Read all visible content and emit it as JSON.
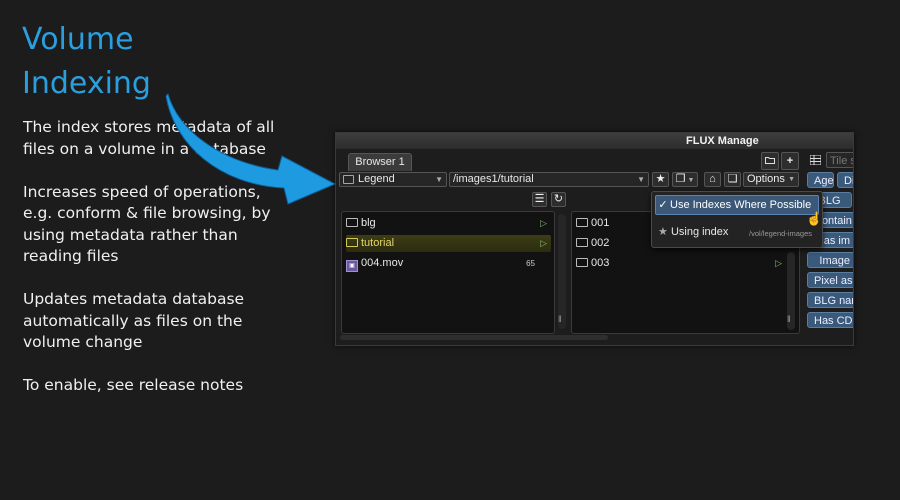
{
  "slide": {
    "title": "Volume Indexing",
    "bullets": [
      "The index stores metadata of all files on a volume in a database",
      "Increases speed of operations, e.g. conform & file browsing, by using metadata rather than reading files",
      "Updates metadata database automatically as files on the volume change",
      "To enable, see release notes"
    ],
    "title_color": "#2a9fe0",
    "arrow_color": "#1e9be0"
  },
  "app": {
    "window_title": "FLUX Manage",
    "tab_label": "Browser 1",
    "new_folder_btn": "folder-icon",
    "add_btn": "+",
    "search_placeholder": "Tile s",
    "legend_select": "Legend",
    "path_select": "/images1/tutorial",
    "options_label": "Options",
    "left_pane": [
      {
        "name": "blg",
        "type": "folder"
      },
      {
        "name": "tutorial",
        "type": "folder",
        "selected": true
      },
      {
        "name": "004.mov",
        "type": "movie",
        "count": "65"
      }
    ],
    "right_pane": [
      {
        "name": "001"
      },
      {
        "name": "002"
      },
      {
        "name": "003"
      }
    ],
    "dropdown": {
      "checkmark": "✓",
      "item1": "Use Indexes Where Possible",
      "item2": "Using index",
      "item2_path": "/vol/legend-images"
    },
    "chips": [
      "Age",
      "Dir",
      "BLG",
      "Contain",
      "Has im",
      "Image",
      "Pixel as",
      "BLG nar",
      "Has CD"
    ]
  }
}
